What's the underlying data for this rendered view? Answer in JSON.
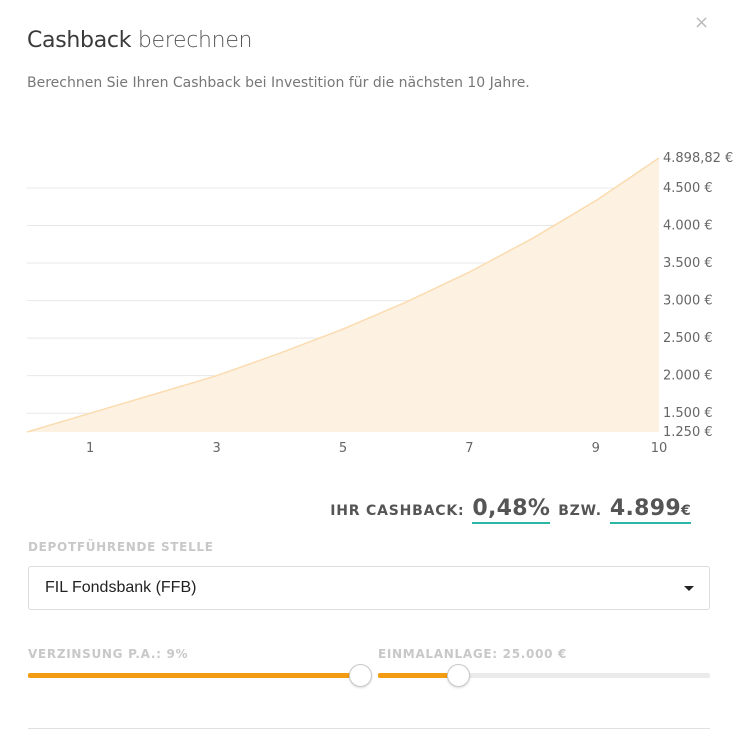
{
  "modal": {
    "title_main": "Cashback",
    "title_light": "berechnen",
    "close_glyph": "×",
    "subtitle": "Berechnen Sie Ihren Cashback bei Investition für die nächsten 10 Jahre."
  },
  "chart_data": {
    "type": "area",
    "x": [
      0,
      1,
      2,
      3,
      4,
      5,
      6,
      7,
      8,
      9,
      10
    ],
    "values": [
      1250,
      1500,
      1750,
      2000,
      2300,
      2620,
      2980,
      3380,
      3830,
      4330,
      4898.82
    ],
    "x_tick_labels": [
      "1",
      "3",
      "5",
      "7",
      "9",
      "10"
    ],
    "x_ticks": [
      1,
      3,
      5,
      7,
      9,
      10
    ],
    "y_ticks": [
      1250,
      1500,
      2000,
      2500,
      3000,
      3500,
      4000,
      4500,
      4898.82
    ],
    "y_tick_labels": [
      "1.250 €",
      "1.500 €",
      "2.000 €",
      "2.500 €",
      "3.000 €",
      "3.500 €",
      "4.000 €",
      "4.500 €",
      "4.898,82 €"
    ],
    "ylim": [
      1250,
      4898.82
    ],
    "xlim": [
      0,
      10
    ],
    "grid": true,
    "colors": {
      "fill": "#fdf1e1",
      "line": "#fbdcb0",
      "grid": "#e8e8e8",
      "tick": "#666666"
    }
  },
  "result": {
    "label": "IHR CASHBACK:",
    "percent": "0,48%",
    "or_label": "BZW.",
    "amount": "4.899",
    "currency": "€",
    "underline_color": "#2ab8a6"
  },
  "depot": {
    "label": "DEPOTFÜHRENDE STELLE",
    "selected": "FIL Fondsbank (FFB)"
  },
  "interest": {
    "label": "VERZINSUNG P.A.: 9%",
    "value_fraction": 1.0
  },
  "investment": {
    "label": "EINMALANLAGE: 25.000 €",
    "value_fraction": 0.24
  },
  "colors": {
    "accent": "#f39c12"
  }
}
